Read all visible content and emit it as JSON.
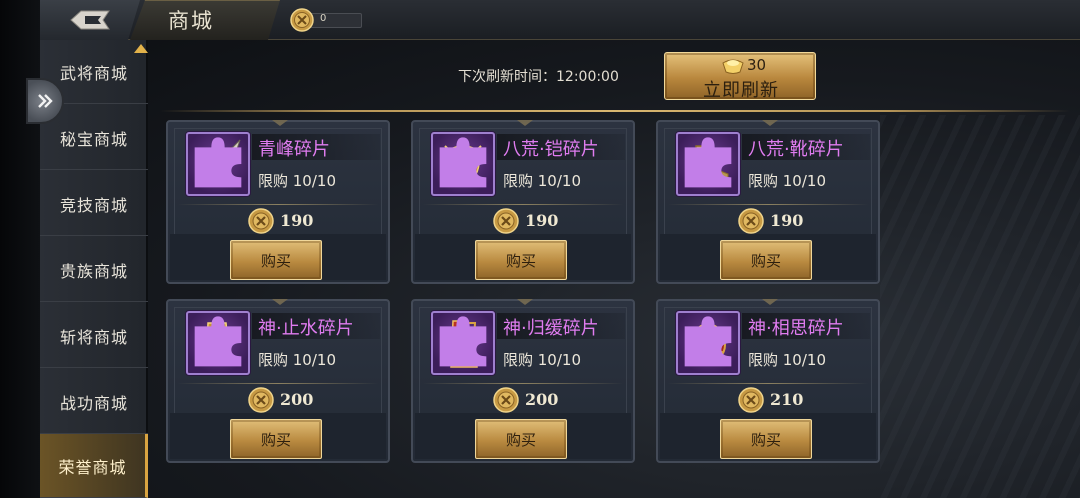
{
  "header": {
    "title": "商城",
    "currency": {
      "icon": "honor-coin-icon",
      "amount": "0"
    }
  },
  "sidebar": {
    "items": [
      {
        "label": "武将商城",
        "active": false
      },
      {
        "label": "秘宝商城",
        "active": false
      },
      {
        "label": "竞技商城",
        "active": false
      },
      {
        "label": "贵族商城",
        "active": false
      },
      {
        "label": "斩将商城",
        "active": false
      },
      {
        "label": "战功商城",
        "active": false
      },
      {
        "label": "荣誉商城",
        "active": true
      }
    ]
  },
  "refresh": {
    "label": "下次刷新时间：12:00:00",
    "cost": "30",
    "cost_icon": "gold-ingot-icon",
    "button_label": "立即刷新"
  },
  "items": [
    {
      "name": "青峰碎片",
      "limit": "限购 10/10",
      "price": "190",
      "icon": "spear-icon",
      "buy": "购买"
    },
    {
      "name": "八荒·铠碎片",
      "limit": "限购 10/10",
      "price": "190",
      "icon": "armor-icon",
      "buy": "购买"
    },
    {
      "name": "八荒·靴碎片",
      "limit": "限购 10/10",
      "price": "190",
      "icon": "boots-icon",
      "buy": "购买"
    },
    {
      "name": "神·止水碎片",
      "limit": "限购 10/10",
      "price": "200",
      "icon": "gauntlet-icon",
      "buy": "购买"
    },
    {
      "name": "神·归缓碎片",
      "limit": "限购 10/10",
      "price": "200",
      "icon": "greaves-icon",
      "buy": "购买"
    },
    {
      "name": "神·相思碎片",
      "limit": "限购 10/10",
      "price": "210",
      "icon": "ring-icon",
      "buy": "购买"
    }
  ],
  "colors": {
    "item_name": "#e07cf0",
    "gold_button": "#c99a4d",
    "active_tab": "#6b5426"
  }
}
